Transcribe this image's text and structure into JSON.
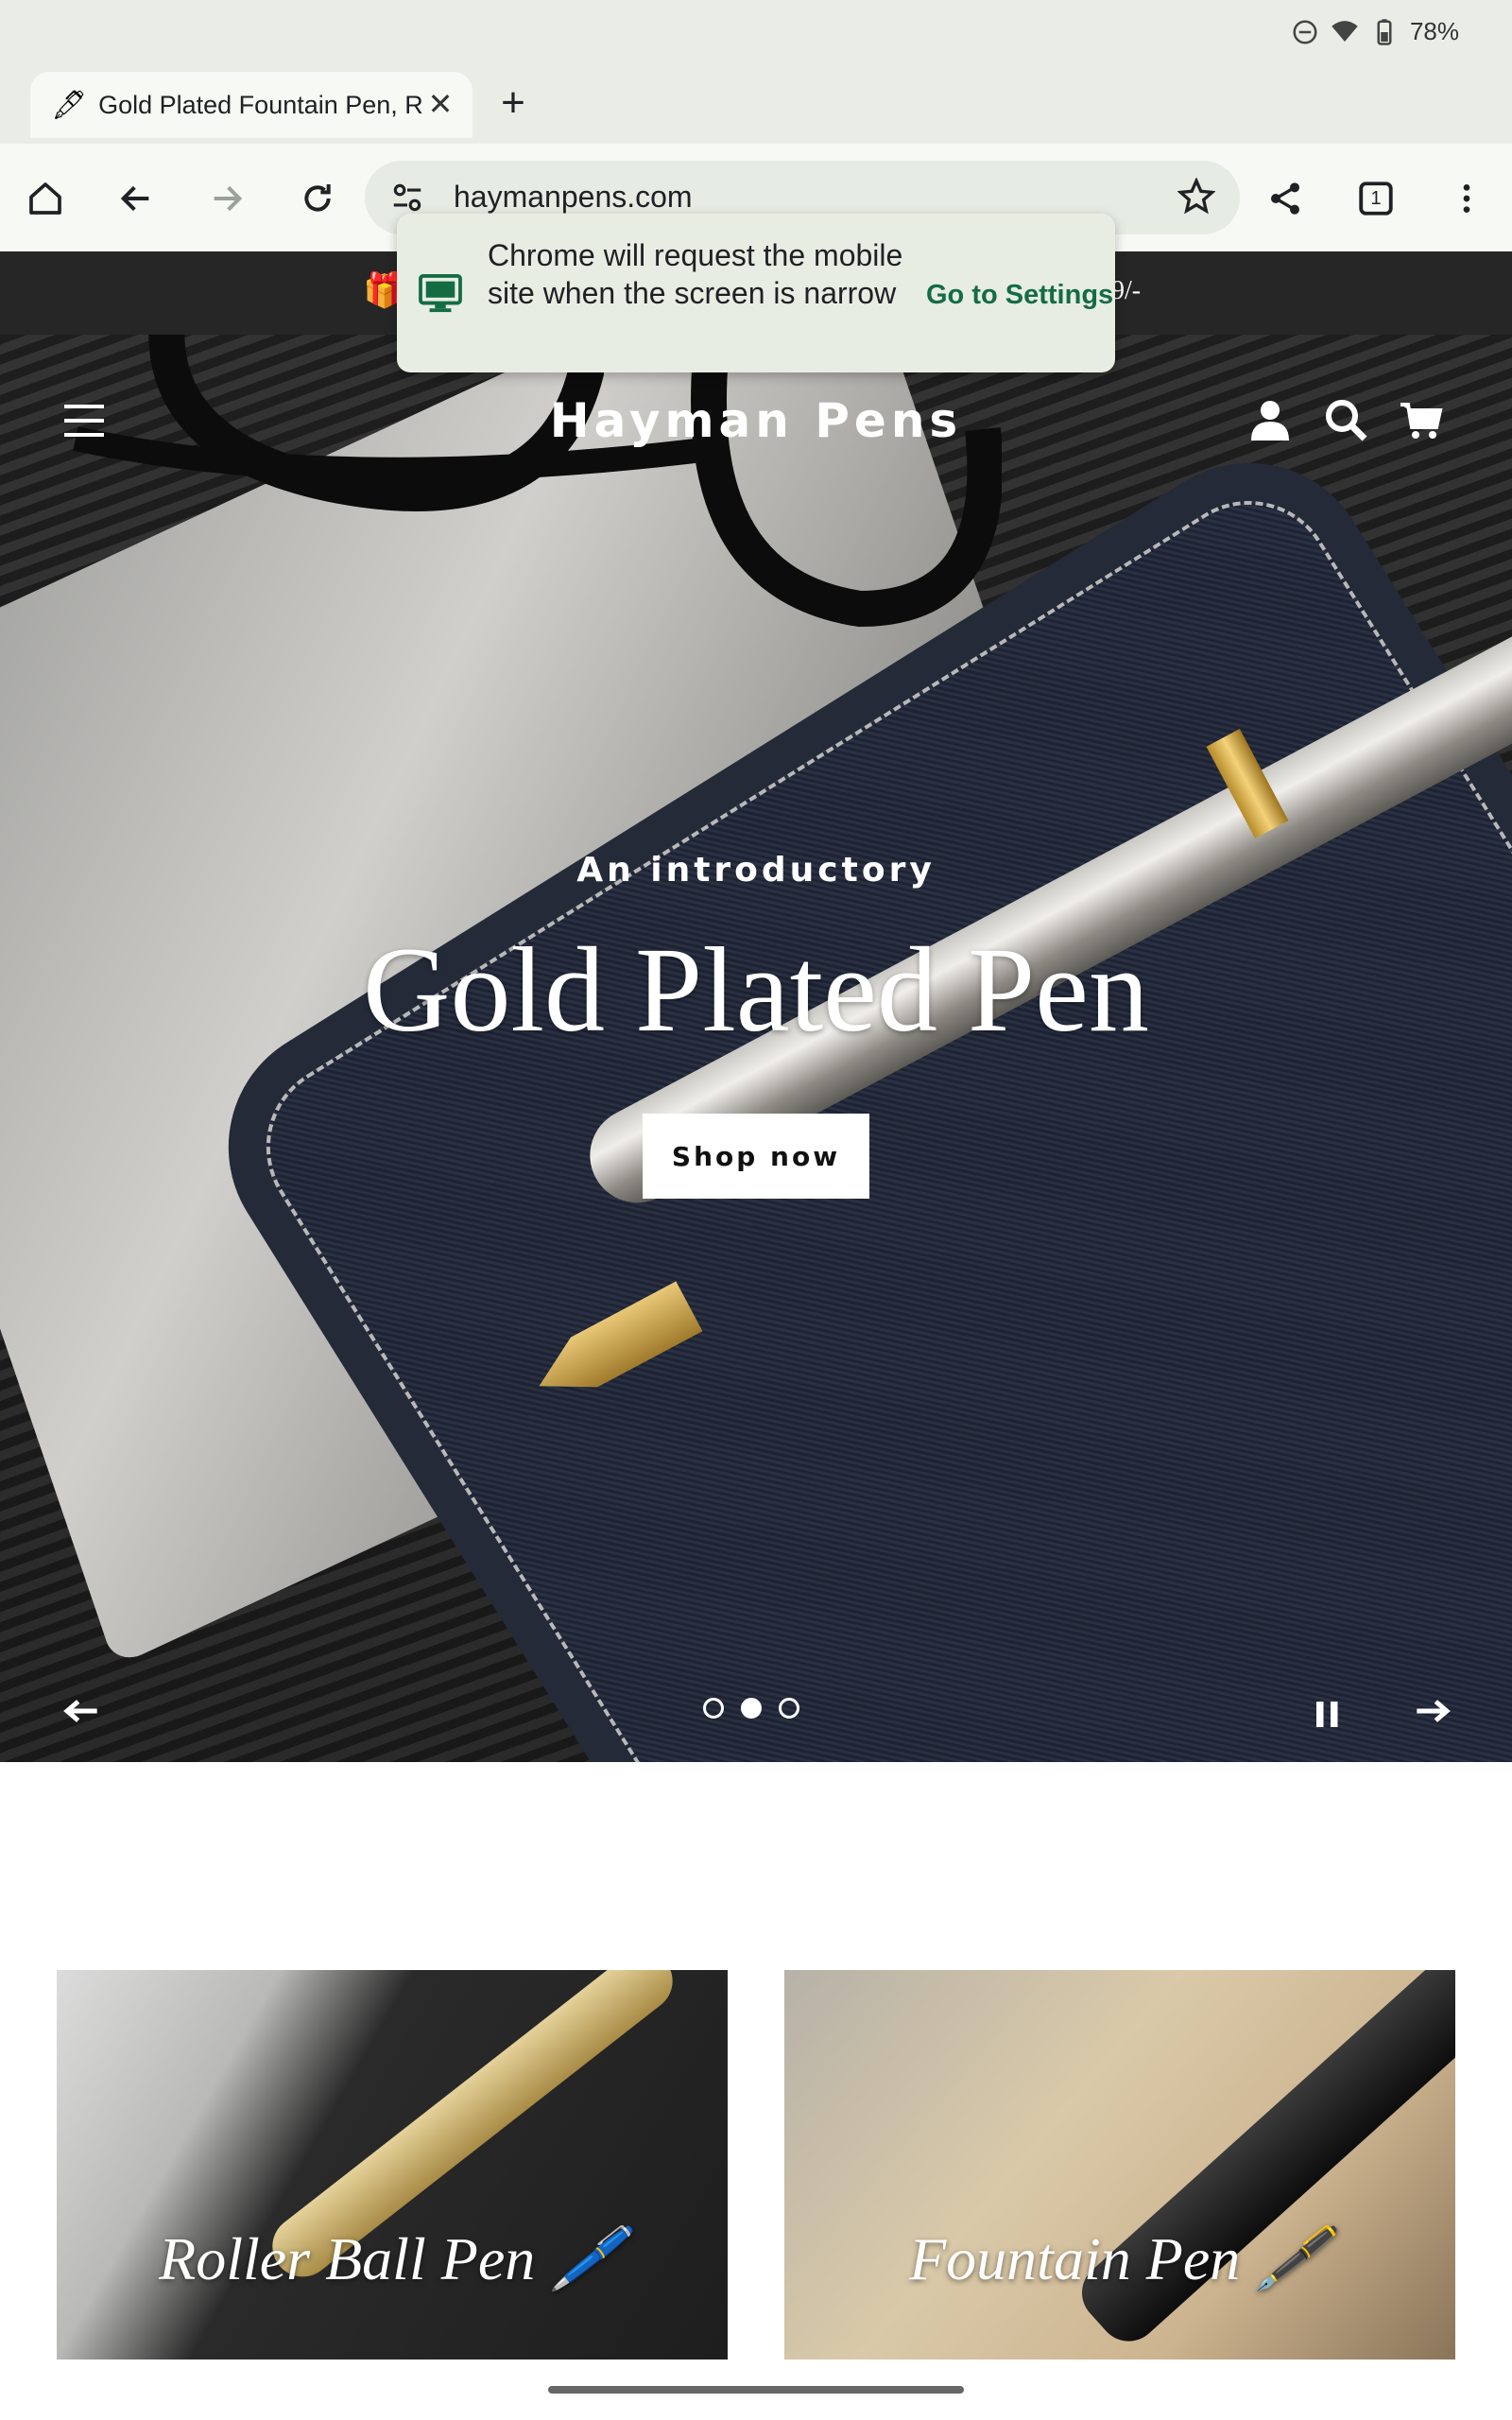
{
  "status_bar": {
    "battery": "78%",
    "icons": [
      "dnd-icon",
      "wifi-icon",
      "battery-icon"
    ]
  },
  "browser": {
    "tab": {
      "title": "Gold Plated Fountain Pen, R",
      "favicon": "pen-favicon-icon"
    },
    "url": "haymanpens.com",
    "tab_count": "1"
  },
  "announcement": {
    "text": "9/-",
    "icon": "gift-icon"
  },
  "popup": {
    "message": "Chrome will request the mobile site when the screen is narrow",
    "link": "Go to Settings"
  },
  "site": {
    "logo": "Hayman Pens"
  },
  "hero": {
    "subtitle": "An introductory",
    "title": "Gold Plated Pen",
    "button": "Shop now",
    "slides_total": 3,
    "active_slide": 2
  },
  "collections": [
    {
      "label": "Roller Ball Pen 🖊️"
    },
    {
      "label": "Fountain Pen 🖋️"
    }
  ],
  "colors": {
    "announcement_bg": "#262626",
    "link_green": "#146c43",
    "browser_bg": "#e9ede6"
  }
}
